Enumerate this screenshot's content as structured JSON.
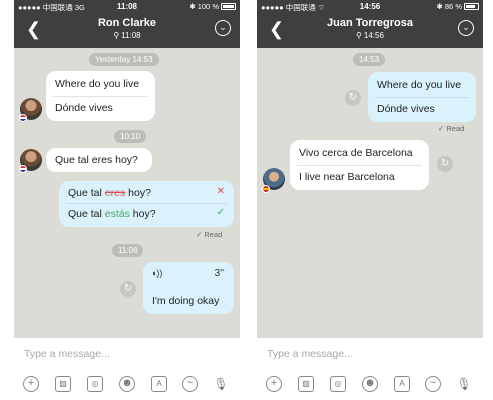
{
  "left": {
    "status": {
      "carrier": "●●●●● 中国联通",
      "network": "3G",
      "time": "11:08",
      "icons": "✱",
      "battery": "100 %"
    },
    "header": {
      "back_icon": "back-chevron",
      "name": "Ron Clarke",
      "subtitle": "11:08",
      "menu_icon": "chevron-down"
    },
    "messages": {
      "stamp1": "Yesterday 14:53",
      "m1_line1": "Where do you live",
      "m1_line2": "Dónde vives",
      "stamp2": "10:10",
      "m2": "Que tal eres hoy?",
      "m3_a": "Que tal ",
      "m3_wrong": "eres",
      "m3_b": " hoy?",
      "m3_c": "Que tal ",
      "m3_right": "estás",
      "m3_d": " hoy?",
      "read1": "✓ Read",
      "stamp3": "11:08",
      "voice_duration": "3''",
      "voice_text": "I'm doing okay"
    },
    "input_placeholder": "Type a message..."
  },
  "right": {
    "status": {
      "carrier": "●●●●● 中国联通",
      "wifi": "⌔",
      "time": "14:56",
      "icons": "✱",
      "battery": "86 %"
    },
    "header": {
      "back_icon": "back-chevron",
      "name": "Juan Torregrosa",
      "subtitle": "14:56",
      "menu_icon": "chevron-down"
    },
    "messages": {
      "stamp1": "14:53",
      "m1_line1": "Where do you live",
      "m1_line2": "Dónde vives",
      "read1": "✓ Read",
      "m2_line1": "Vivo cerca de Barcelona",
      "m2_line2": "I live near Barcelona"
    },
    "input_placeholder": "Type a message..."
  },
  "colors": {
    "header_bg": "#3f3f3f",
    "chat_bg": "#dcdcd6",
    "outgoing_bubble": "#d9f2fb",
    "incoming_bubble": "#ffffff",
    "wrong": "#e05050",
    "correct": "#3cae55"
  },
  "toolbar_icons": [
    "plus-icon",
    "image-icon",
    "camera-icon",
    "sticker-icon",
    "translate-icon",
    "emoji-icon",
    "microphone-icon"
  ]
}
